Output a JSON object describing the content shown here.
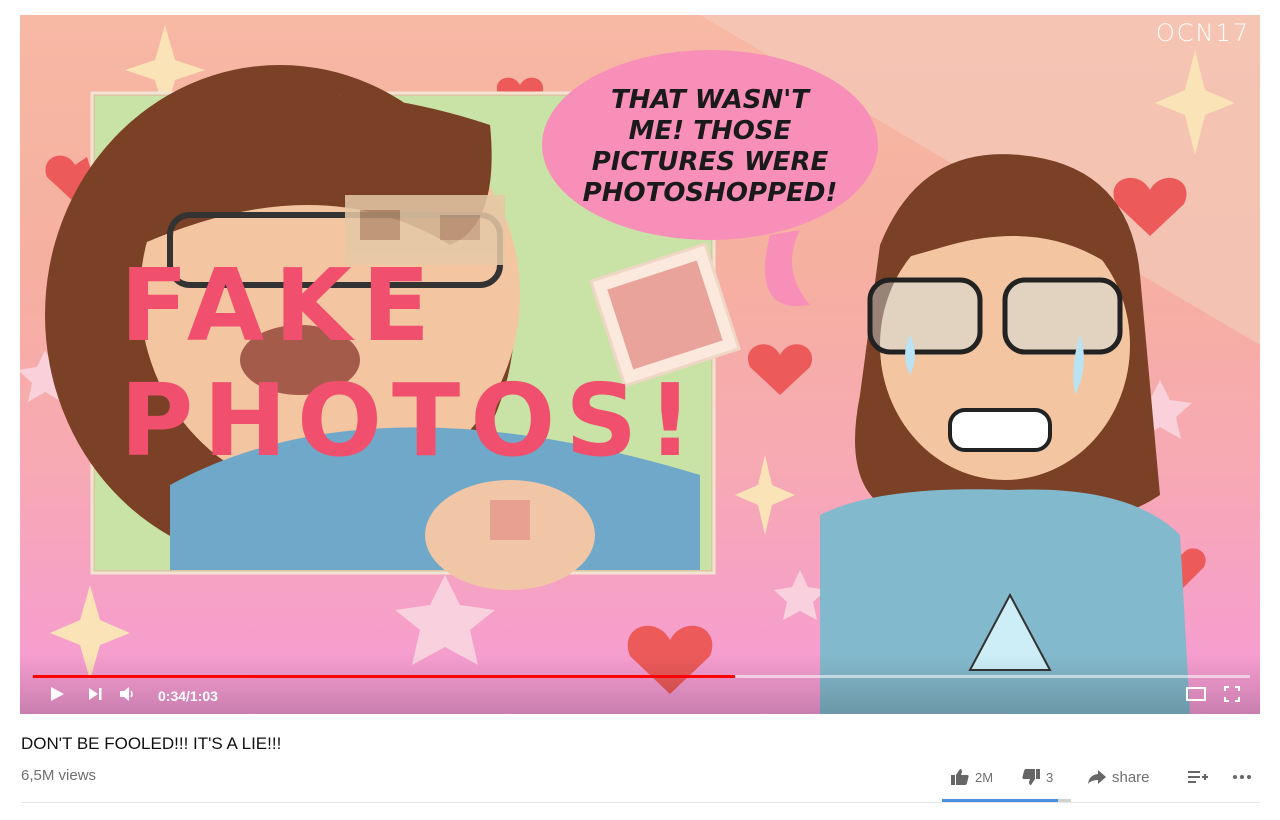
{
  "video": {
    "watermark": "OCN17",
    "speech_bubble": [
      "THAT WASN'T",
      "ME! THOSE",
      "PICTURES WERE",
      "PHOTOSHOPPED!"
    ],
    "caption_lines": [
      "FAKE",
      "PHOTOS!"
    ]
  },
  "player": {
    "time_display": "0:34/1:03",
    "progress": 0.577,
    "icons": [
      "play-icon",
      "next-icon",
      "volume-icon",
      "theater-mode-icon",
      "fullscreen-icon"
    ]
  },
  "info": {
    "title": "DON'T BE FOOLED!!! IT'S A LIE!!!",
    "views": "6,5M views",
    "likes": "2M",
    "dislikes": "3",
    "share_label": "share",
    "like_ratio": 0.9
  },
  "colors": {
    "progress": "#ff0000",
    "like_bar": "#4a90e2",
    "caption": "#f0506e",
    "bubble": "#f88fb8"
  }
}
